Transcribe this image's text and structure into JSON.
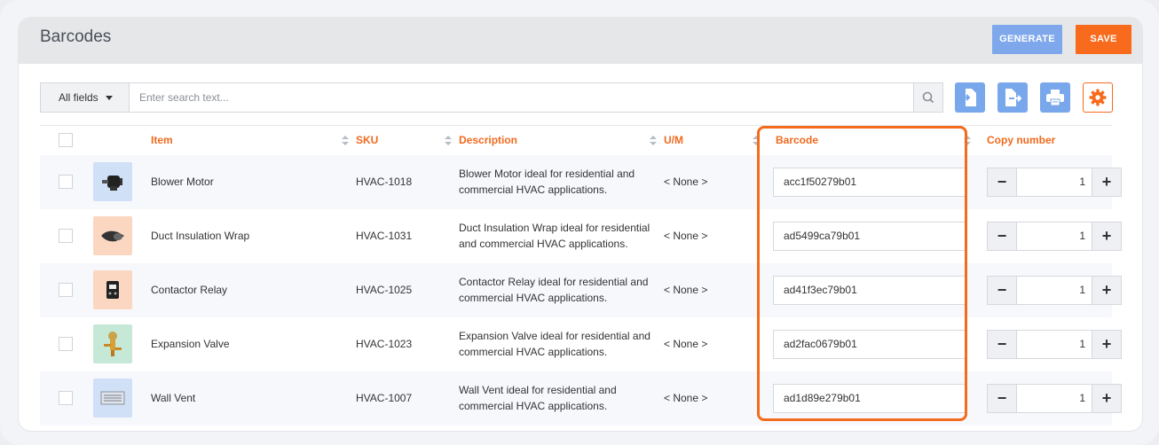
{
  "page": {
    "title": "Barcodes"
  },
  "header": {
    "generate_label": "GENERATE",
    "save_label": "SAVE"
  },
  "search": {
    "field_label": "All fields",
    "placeholder": "Enter search text..."
  },
  "toolbar": {
    "icons": [
      "import-icon",
      "export-icon",
      "print-icon",
      "gear-icon"
    ]
  },
  "columns": {
    "item": "Item",
    "sku": "SKU",
    "description": "Description",
    "um": "U/M",
    "barcode": "Barcode",
    "copy": "Copy number"
  },
  "rows": [
    {
      "item": "Blower Motor",
      "sku": "HVAC-1018",
      "description_line1": "Blower Motor ideal for residential and",
      "description_line2": "commercial HVAC applications.",
      "um": "< None >",
      "barcode": "acc1f50279b01",
      "copy": "1"
    },
    {
      "item": "Duct Insulation Wrap",
      "sku": "HVAC-1031",
      "description_line1": "Duct Insulation Wrap ideal for residential",
      "description_line2": "and commercial HVAC applications.",
      "um": "< None >",
      "barcode": "ad5499ca79b01",
      "copy": "1"
    },
    {
      "item": "Contactor Relay",
      "sku": "HVAC-1025",
      "description_line1": "Contactor Relay ideal for residential and",
      "description_line2": "commercial HVAC applications.",
      "um": "< None >",
      "barcode": "ad41f3ec79b01",
      "copy": "1"
    },
    {
      "item": "Expansion Valve",
      "sku": "HVAC-1023",
      "description_line1": "Expansion Valve ideal for residential and",
      "description_line2": "commercial HVAC applications.",
      "um": "< None >",
      "barcode": "ad2fac0679b01",
      "copy": "1"
    },
    {
      "item": "Wall Vent",
      "sku": "HVAC-1007",
      "description_line1": "Wall Vent ideal for residential and",
      "description_line2": "commercial HVAC applications.",
      "um": "< None >",
      "barcode": "ad1d89e279b01",
      "copy": "1"
    }
  ],
  "stepper": {
    "minus": "−",
    "plus": "+"
  },
  "colors": {
    "accent": "#f86a1c",
    "primary": "#79a7ec"
  }
}
